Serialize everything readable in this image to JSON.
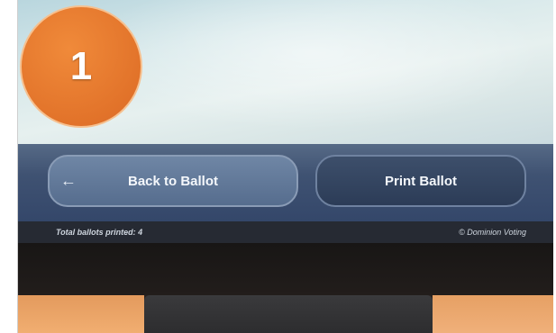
{
  "step_badge": {
    "number": "1"
  },
  "buttons": {
    "back_label": "Back to Ballot",
    "back_arrow": "←",
    "print_label": "Print Ballot"
  },
  "footer": {
    "total_printed": "Total ballots printed: 4",
    "copyright": "© Dominion Voting"
  },
  "colors": {
    "badge": "#e2732a",
    "action_bar": "#3f5272",
    "back_button": "#6f86a5",
    "print_button": "#2c3c57"
  }
}
